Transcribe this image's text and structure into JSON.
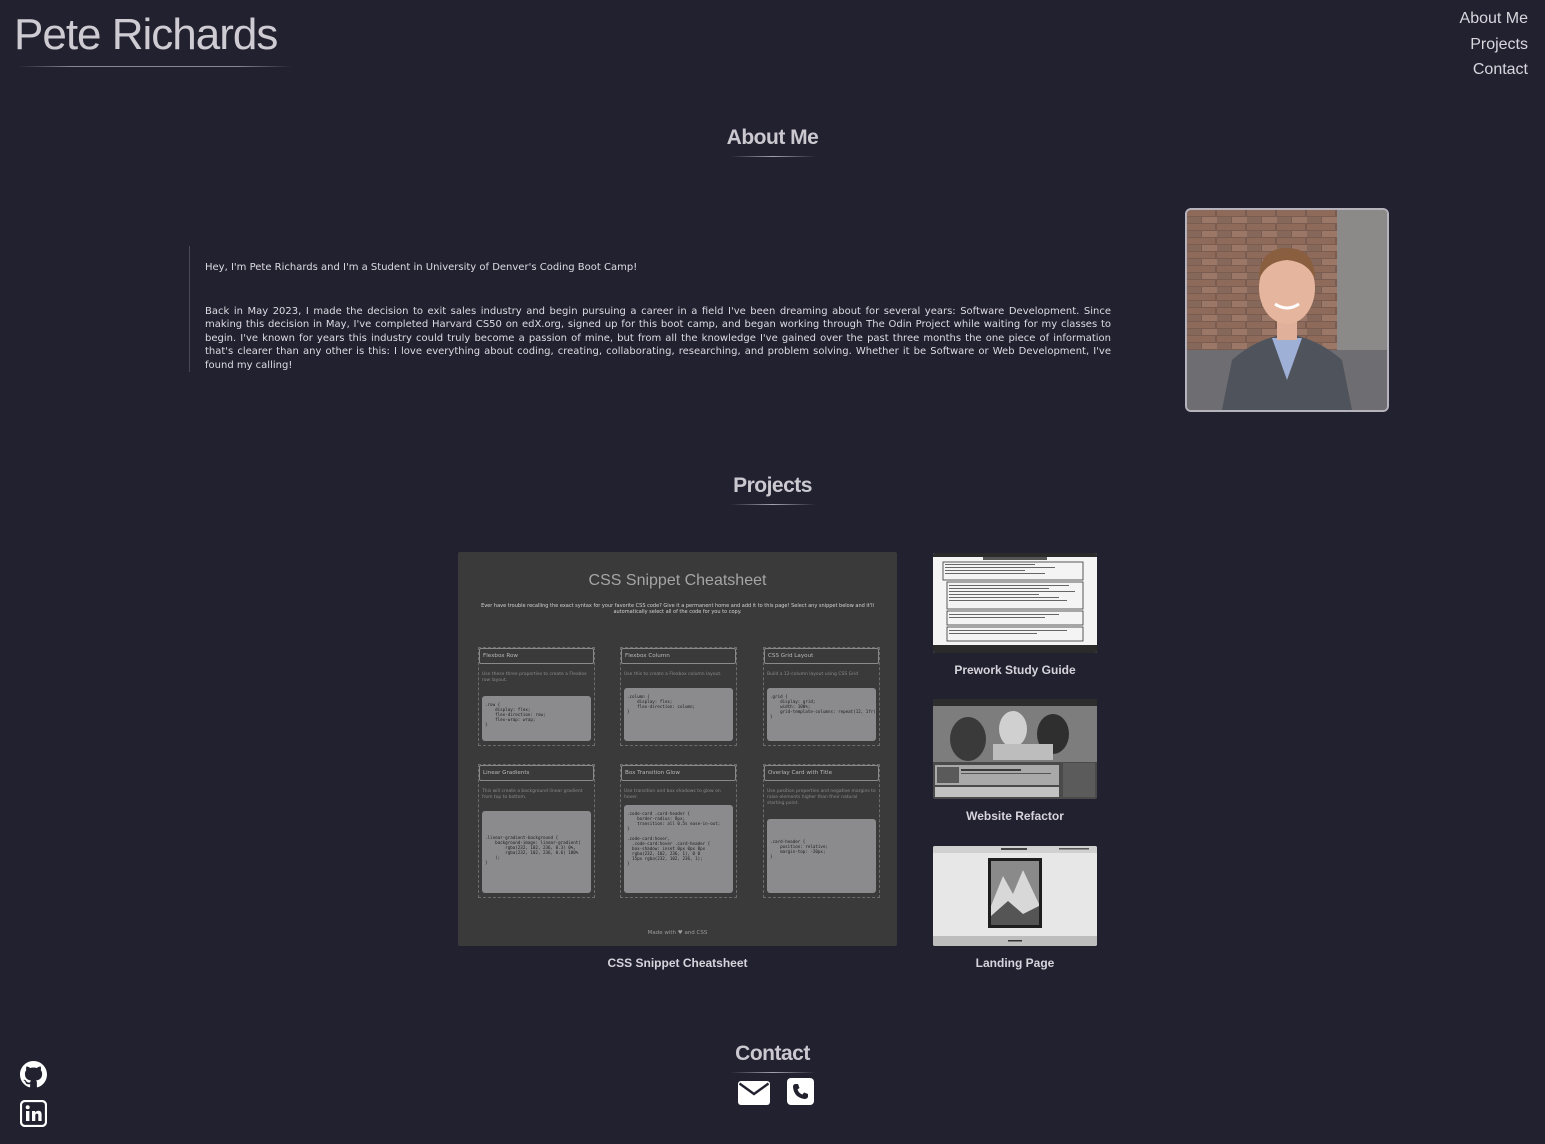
{
  "brand": {
    "name": "Pete Richards"
  },
  "nav": {
    "items": [
      "About Me",
      "Projects",
      "Contact"
    ]
  },
  "about": {
    "heading": "About Me",
    "intro": "Hey, I'm Pete Richards and I'm a Student in University of Denver's Coding Boot Camp!",
    "body": "Back in May 2023, I made the decision to exit sales industry and begin pursuing a career in a field I've been dreaming about for several years: Software Development. Since making this decision in May, I've completed Harvard CS50 on edX.org, signed up for this boot camp, and began working through The Odin Project while waiting for my classes to begin. I've known for years this industry could truly become a passion of mine, but from all the knowledge I've gained over the past three months the one piece of information that's clearer than any other is this: I love everything about coding, creating, collaborating, researching, and problem solving. Whether it be Software or Web Development, I've found my calling!"
  },
  "projects": {
    "heading": "Projects",
    "featured": {
      "caption": "CSS Snippet Cheatsheet",
      "screenshot": {
        "title": "CSS Snippet Cheatsheet",
        "subtitle": "Ever have trouble recalling the exact syntax for your favorite CSS code? Give it a permanent home and add it to this page! Select any snippet below and it'll automatically select all of the code for you to copy.",
        "cards": [
          {
            "title": "Flexbox Row",
            "desc": "Use these three properties to create a Flexbox row layout.",
            "code": ".row {\n    display: flex;\n    flex-direction: row;\n    flex-wrap: wrap;\n}"
          },
          {
            "title": "Flexbox Column",
            "desc": "Use this to create a Flexbox column layout.",
            "code": ".column {\n    display: flex;\n    flex-direction: column;\n}"
          },
          {
            "title": "CSS Grid Layout",
            "desc": "Build a 12-column layout using CSS Grid",
            "code": ".grid {\n    display: grid;\n    width: 100%;\n    grid-template-columns: repeat(12, 1fr);\n}"
          },
          {
            "title": "Linear Gradients",
            "desc": "This will create a background linear gradient from top to bottom.",
            "code": ".linear-gradient-background {\n    background-image: linear-gradient(\n        rgba(232, 102, 236, 0.3) 0%,\n        rgba(232, 102, 236, 0.6) 100%\n    );\n}"
          },
          {
            "title": "Box Transition Glow",
            "desc": "Use transition and box shadows to glow on hover.",
            "code": ".code-card .card-header {\n    border-radius: 8px;\n    transition: all 0.5s ease-in-out;\n}\n\n.code-card:hover,\n  .code-card:hover .card-header {\n  box-shadow: inset 0px 0px 8px\n  rgba(232, 102, 236, 1), 0 0\n  15px rgba(232, 102, 236, 1);\n}"
          },
          {
            "title": "Overlay Card with Title",
            "desc": "Use position properties and negative margins to raise elements higher than their natural starting point.",
            "code": ".card-header {\n    position: relative;\n    margin-top: -20px;\n}"
          }
        ],
        "footer": "Made with ♥ and CSS"
      }
    },
    "others": [
      {
        "caption": "Prework Study Guide"
      },
      {
        "caption": "Website Refactor"
      },
      {
        "caption": "Landing Page"
      }
    ]
  },
  "contact": {
    "heading": "Contact"
  }
}
